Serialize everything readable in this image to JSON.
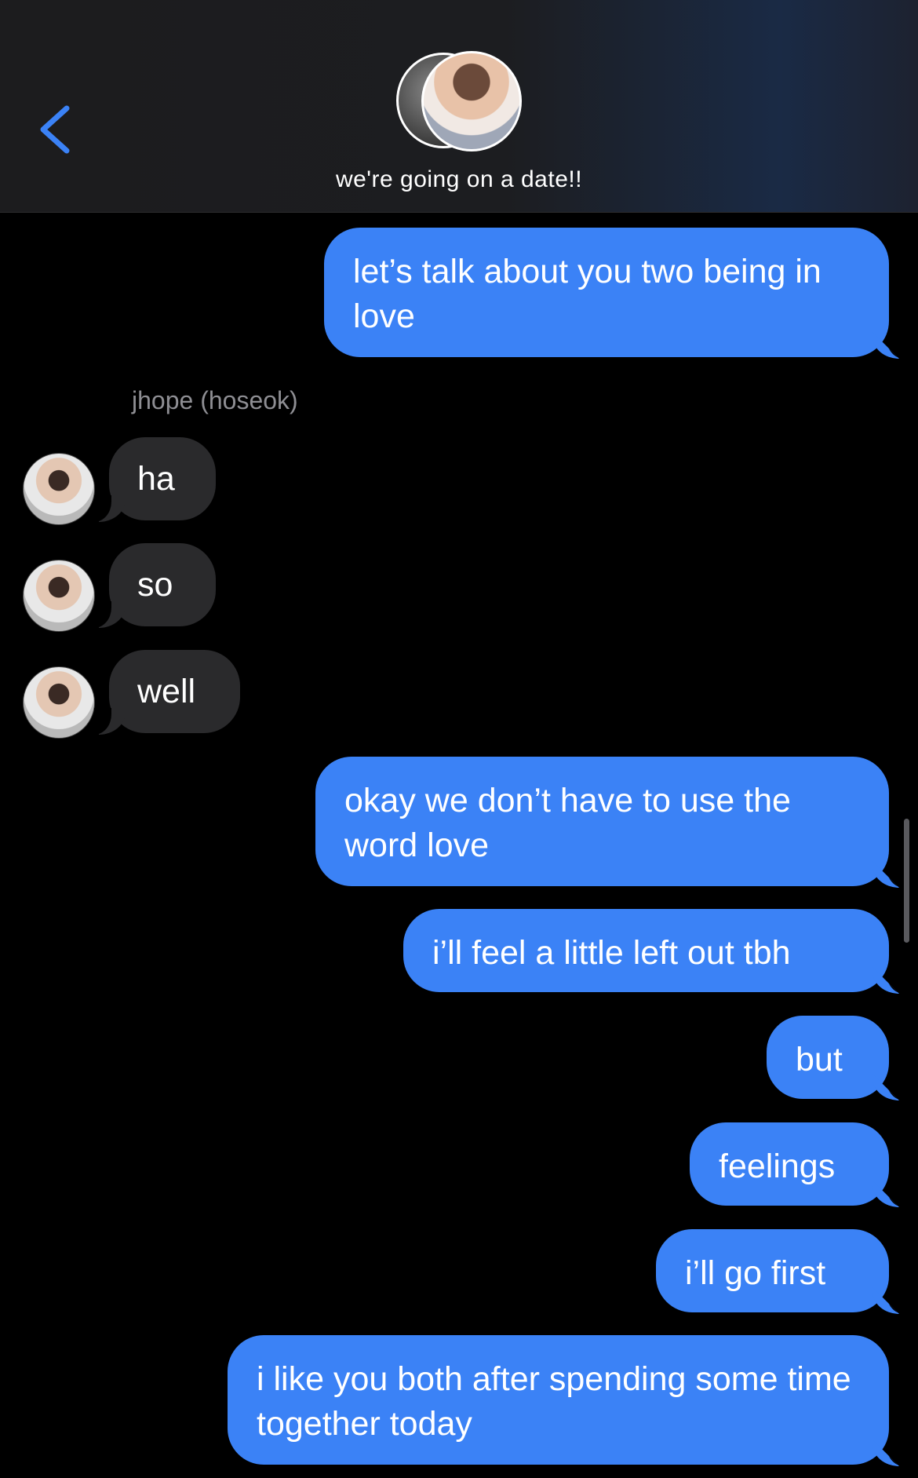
{
  "header": {
    "back_icon": "chevron-left-icon",
    "group_title": "we're going on a date!!",
    "accent_color": "#3b82f6"
  },
  "messages": {
    "m1": "let’s talk about you two being in love",
    "sender": "jhope (hoseok)",
    "m2": "ha",
    "m3": "so",
    "m4": "well",
    "m5": "okay we don’t have to use the word love",
    "m6": "i’ll feel a little left out tbh",
    "m7": "but",
    "m8": "feelings",
    "m9": "i’ll go first",
    "m10": "i like you both after spending some time together today"
  },
  "colors": {
    "outgoing_bubble": "#3b82f6",
    "incoming_bubble": "#2a2a2c",
    "background": "#000000"
  }
}
